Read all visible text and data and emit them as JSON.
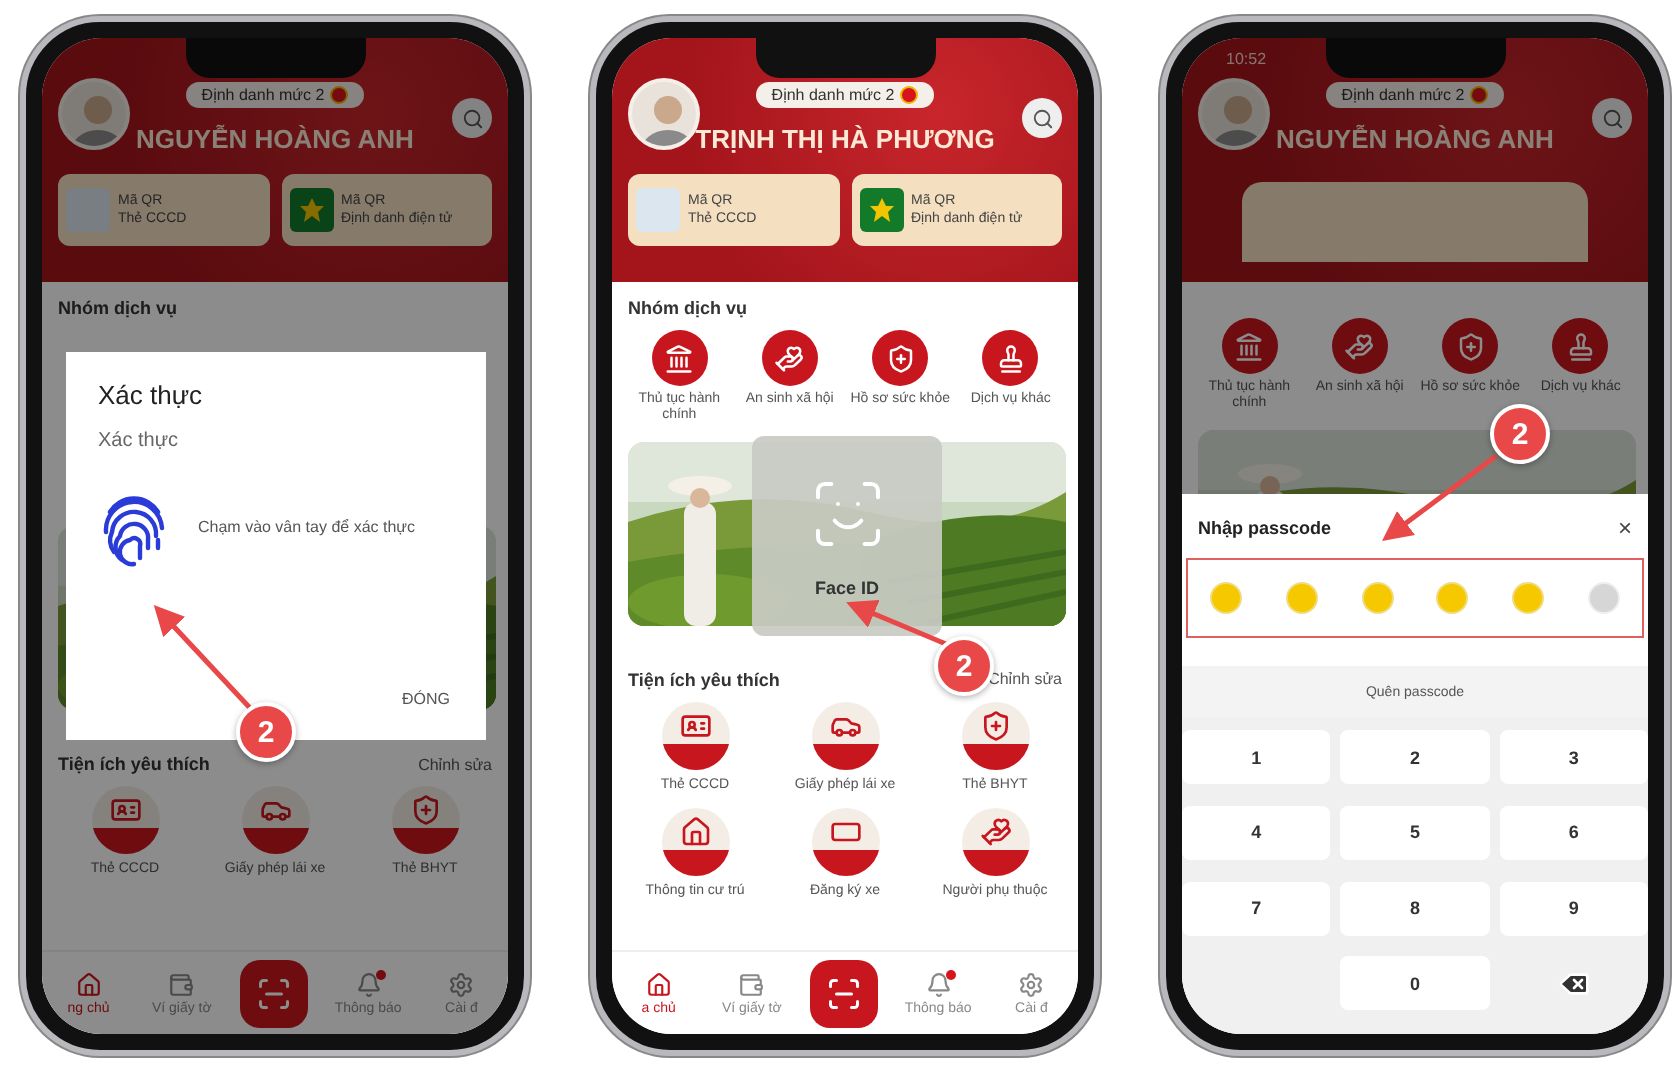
{
  "phones": [
    {
      "profile": {
        "level_badge": "Định danh mức 2",
        "name": "NGUYỄN HOÀNG ANH"
      },
      "qr_cards": [
        {
          "title": "Mã QR",
          "subtitle": "Thẻ CCCD"
        },
        {
          "title": "Mã QR",
          "subtitle": "Định danh điện tử"
        }
      ],
      "services": {
        "title": "Nhóm dịch vụ"
      },
      "favorites": {
        "title": "Tiện ích yêu thích",
        "edit_link": "Chỉnh sửa",
        "items": [
          {
            "label": "Thẻ CCCD"
          },
          {
            "label": "Giấy phép lái xe"
          },
          {
            "label": "Thẻ BHYT"
          }
        ]
      },
      "nav": [
        {
          "kind": "tab",
          "label": "ng chủ",
          "selected": true,
          "unread": false
        },
        {
          "kind": "tab",
          "label": "Ví giấy tờ",
          "selected": false,
          "unread": false
        },
        {
          "kind": "scan"
        },
        {
          "kind": "tab",
          "label": "Thông báo",
          "selected": false,
          "unread": true
        },
        {
          "kind": "tab",
          "label": "Cài đ",
          "selected": false,
          "unread": false
        }
      ],
      "dimmed": true,
      "dialog": {
        "kind": "fingerprint",
        "title": "Xác thực",
        "subtitle": "Xác thực",
        "message": "Chạm vào vân tay để xác thực",
        "button": "ĐÓNG"
      },
      "step": "2"
    },
    {
      "profile": {
        "level_badge": "Định danh mức 2",
        "name": "TRỊNH THỊ HÀ PHƯƠNG"
      },
      "qr_cards": [
        {
          "title": "Mã QR",
          "subtitle": "Thẻ CCCD"
        },
        {
          "title": "Mã QR",
          "subtitle": "Định danh điện tử"
        }
      ],
      "services": {
        "title": "Nhóm dịch vụ",
        "items": [
          {
            "label": "Thủ tục hành chính"
          },
          {
            "label": "An sinh xã hội"
          },
          {
            "label": "Hồ sơ sức khỏe"
          },
          {
            "label": "Dịch vụ khác"
          }
        ]
      },
      "favorites": {
        "title": "Tiện ích yêu thích",
        "edit_link": "Chỉnh sửa",
        "items": [
          {
            "label": "Thẻ CCCD"
          },
          {
            "label": "Giấy phép lái xe"
          },
          {
            "label": "Thẻ BHYT"
          },
          {
            "label": "Thông tin cư trú"
          },
          {
            "label": "Đăng ký xe"
          },
          {
            "label": "Người phụ thuộc"
          }
        ]
      },
      "nav": [
        {
          "kind": "tab",
          "label": "a chủ",
          "selected": true,
          "unread": false
        },
        {
          "kind": "tab",
          "label": "Ví giấy tờ",
          "selected": false,
          "unread": false
        },
        {
          "kind": "scan"
        },
        {
          "kind": "tab",
          "label": "Thông báo",
          "selected": false,
          "unread": true
        },
        {
          "kind": "tab",
          "label": "Cài đ",
          "selected": false,
          "unread": false
        }
      ],
      "dimmed": false,
      "dialog": {
        "kind": "face_id",
        "title": "Face ID"
      },
      "step": "2"
    },
    {
      "status_time": "10:52",
      "profile": {
        "level_badge": "Định danh mức 2",
        "name": "NGUYỄN HOÀNG ANH"
      },
      "services": {
        "items": [
          {
            "label": "Thủ tục hành chính"
          },
          {
            "label": "An sinh xã hội"
          },
          {
            "label": "Hồ sơ sức khỏe"
          },
          {
            "label": "Dịch vụ khác"
          }
        ]
      },
      "dimmed": true,
      "dialog": {
        "kind": "passcode",
        "title": "Nhập passcode",
        "close": "×",
        "forgot": "Quên passcode",
        "keys": [
          "1",
          "2",
          "3",
          "4",
          "5",
          "6",
          "7",
          "8",
          "9",
          "0"
        ],
        "dots": [
          {
            "filled": true
          },
          {
            "filled": true
          },
          {
            "filled": true
          },
          {
            "filled": true
          },
          {
            "filled": true
          },
          {
            "filled": false
          }
        ]
      },
      "step": "2"
    }
  ]
}
